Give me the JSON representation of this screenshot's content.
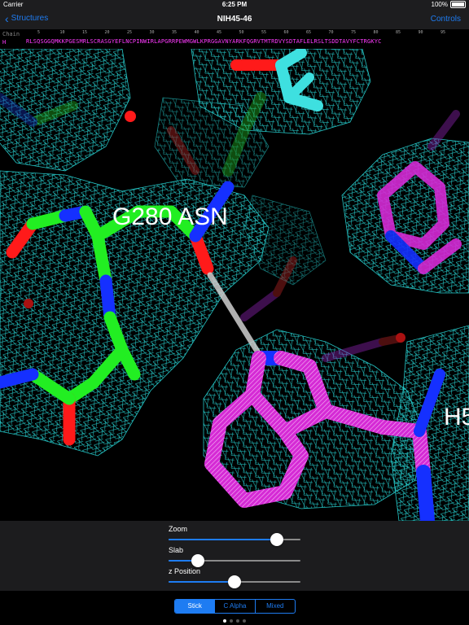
{
  "status": {
    "carrier": "Carrier",
    "time": "6:25 PM",
    "battery": "100%"
  },
  "nav": {
    "back_label": "Structures",
    "title": "NIH45-46",
    "controls_label": "Controls"
  },
  "sequence": {
    "header_label": "Chain",
    "chain_id": "H",
    "positions": [
      "5",
      "10",
      "15",
      "20",
      "25",
      "30",
      "35",
      "40",
      "45",
      "50",
      "55",
      "60",
      "65",
      "70",
      "75",
      "80",
      "85",
      "90",
      "95"
    ],
    "sequence_text": "RLSQSGGQMKKPGESMRLSCRASGYEFLNCPINWIRLAPGRRPEWMGWLKPRGGAVNYARKFQGRVTMTRDVYSDTAFLELRSLTSDDTAVYFCTRGKYC"
  },
  "viewer": {
    "residue_label_1": "G280 ASN",
    "residue_label_2": "H5",
    "colors": {
      "mesh": "#27cfcf",
      "carbon_green": "#22ee22",
      "nitrogen": "#1530ff",
      "oxygen": "#ff1a1a",
      "magenta": "#e030e0",
      "cyan_stick": "#3ee0e0"
    }
  },
  "controls": {
    "zoom": {
      "label": "Zoom",
      "value": 0.82
    },
    "slab": {
      "label": "Slab",
      "value": 0.22
    },
    "zpos": {
      "label": "z Position",
      "value": 0.5
    }
  },
  "display_modes": {
    "options": [
      "Stick",
      "C Alpha",
      "Mixed"
    ],
    "selected": "Stick"
  },
  "pages": {
    "count": 4,
    "current": 0
  }
}
